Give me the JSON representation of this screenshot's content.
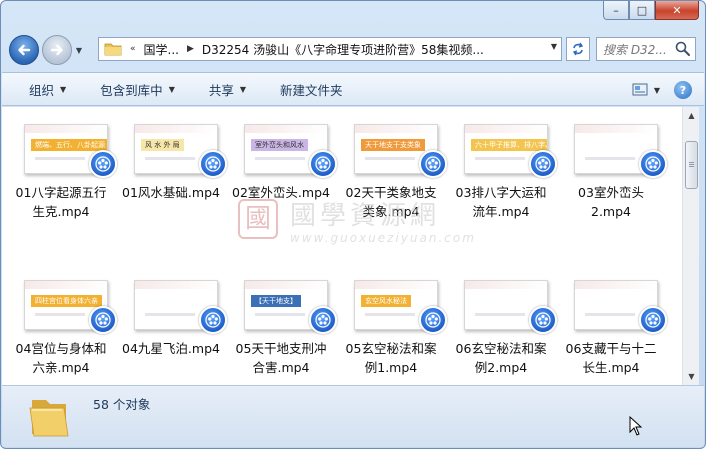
{
  "window": {
    "caption_buttons": {
      "minimize": "–",
      "maximize": "□",
      "close": "✕"
    }
  },
  "address": {
    "overflow": "«",
    "crumbs": [
      "国学...",
      "D32254 汤骏山《八字命理专项进阶营》58集视频..."
    ]
  },
  "search": {
    "placeholder": "搜索 D32..."
  },
  "toolbar": {
    "organize": "组织",
    "include_in_library": "包含到库中",
    "share": "共享",
    "new_folder": "新建文件夹"
  },
  "watermark": {
    "seal": "國",
    "title": "國學資源網",
    "url": "www.guoxueziyuan.com"
  },
  "files": [
    {
      "line1": "01八字起源五行",
      "line2": "生克.mp4",
      "thumb_text": "燃端、五行、八卦起源",
      "thumb_color": "#f2b130"
    },
    {
      "line1": "01风水基础.mp4",
      "line2": "",
      "thumb_text": "风 水 外 局",
      "thumb_color": "#f6e6a8"
    },
    {
      "line1": "02室外峦头.mp4",
      "line2": "",
      "thumb_text": "室外峦头和风水",
      "thumb_color": "#c9b6e4"
    },
    {
      "line1": "02天干类象地支",
      "line2": "类象.mp4",
      "thumb_text": "天干地支干支类象",
      "thumb_color": "#f09a3c"
    },
    {
      "line1": "03排八字大运和",
      "line2": "流年.mp4",
      "thumb_text": "六十甲子推算、排八字、排大运",
      "thumb_color": "#f3c54f"
    },
    {
      "line1": "03室外峦头",
      "line2": "2.mp4",
      "thumb_text": "",
      "thumb_color": "#8fa7bd"
    },
    {
      "line1": "04宫位与身体和",
      "line2": "六亲.mp4",
      "thumb_text": "四柱宫位看身体六亲",
      "thumb_color": "#f2b130"
    },
    {
      "line1": "04九星飞泊.mp4",
      "line2": "",
      "thumb_text": "",
      "thumb_color": "#d9cdee"
    },
    {
      "line1": "05天干地支刑冲",
      "line2": "合害.mp4",
      "thumb_text": "【天干地支】",
      "thumb_color": "#3b6fb6"
    },
    {
      "line1": "05玄空秘法和案",
      "line2": "例1.mp4",
      "thumb_text": "玄空风水秘法",
      "thumb_color": "#f2b130"
    },
    {
      "line1": "06玄空秘法和案",
      "line2": "例2.mp4",
      "thumb_text": "",
      "thumb_color": "#e83a2d"
    },
    {
      "line1": "06支藏干与十二",
      "line2": "长生.mp4",
      "thumb_text": "",
      "thumb_color": "#2f5fa8"
    }
  ],
  "status": {
    "count_text": "58 个对象"
  },
  "colors": {
    "accent": "#2a66b5",
    "toolbar_text": "#1e395b",
    "media_badge": "#1d5dc9"
  }
}
